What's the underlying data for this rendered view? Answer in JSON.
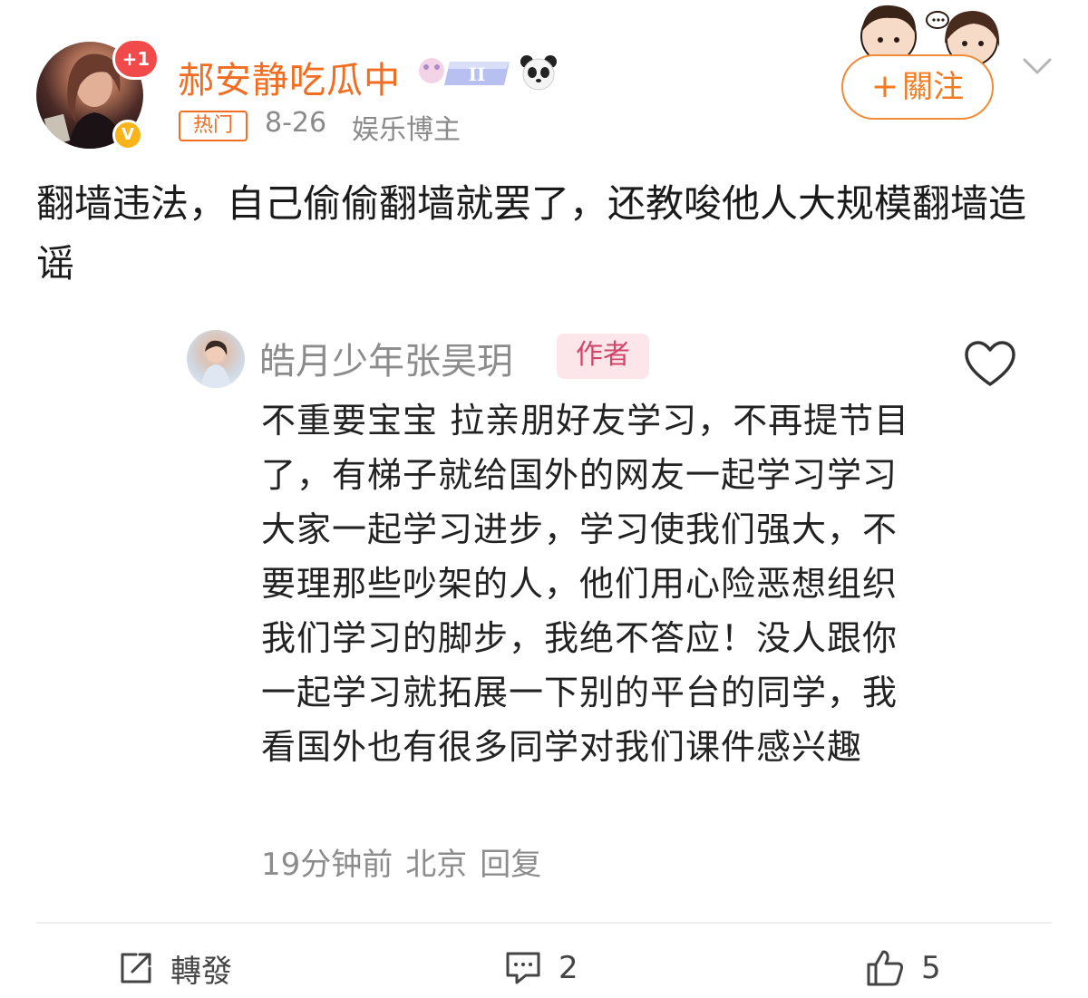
{
  "author": {
    "name": "郝安静吃瓜中",
    "notification_badge": "+1",
    "verified_mark": "V",
    "hot_tag": "热门",
    "date": "8-26",
    "role": "娱乐博主",
    "rank_badge_text": "II"
  },
  "follow_button": {
    "plus": "+",
    "label": "關注"
  },
  "post": {
    "text": "翻墙违法，自己偷偷翻墙就罢了，还教唆他人大规模翻墙造谣"
  },
  "quoted_comment": {
    "name": "皓月少年张昊玥",
    "tag": "作者",
    "body": "不重要宝宝 拉亲朋好友学习，不再提节目了，有梯子就给国外的网友一起学习学习 大家一起学习进步，学习使我们强大，不要理那些吵架的人，他们用心险恶想组织我们学习的脚步，我绝不答应！没人跟你一起学习就拓展一下别的平台的同学，我看国外也有很多同学对我们课件感兴趣",
    "time": "19分钟前",
    "location": "北京",
    "reply": "回复"
  },
  "actions": {
    "share_label": "轉發",
    "comment_count": "2",
    "like_count": "5"
  },
  "colors": {
    "brand_orange": "#f26d21",
    "author_tag_bg": "#fde6ea",
    "author_tag_text": "#d0466a"
  },
  "icons": [
    "share-icon",
    "comment-icon",
    "like-icon",
    "heart-icon",
    "chevron-down-icon",
    "panda-icon"
  ]
}
